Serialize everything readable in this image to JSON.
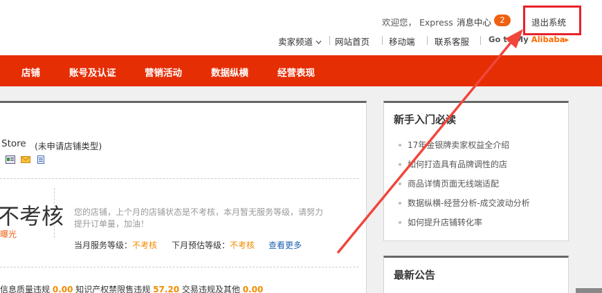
{
  "header": {
    "welcome": "欢迎您， Express",
    "message_center": "消息中心",
    "message_count": "2",
    "logout": "退出系统",
    "subnav": [
      "卖家频道",
      "网站首页",
      "移动端",
      "联系客服"
    ],
    "goto_prefix": "Go to My ",
    "goto_brand": "Alibaba",
    "goto_suffix": "▸"
  },
  "mainnav": [
    "店铺",
    "账号及认证",
    "营销活动",
    "数据纵横",
    "经营表现"
  ],
  "store": {
    "name": "Store",
    "type": "(未申请店铺类型)",
    "status_big": "不考核",
    "status_sub": "曝光",
    "description": "您的店铺，上个月的店铺状态是不考核，本月暂无服务等级，请努力提升订单量，加油！",
    "current_label": "当月服务等级：",
    "current_value": "不考核",
    "next_label": "下月预估等级：",
    "next_value": "不考核",
    "more": "查看更多"
  },
  "violations": {
    "label1": "信息质量违规",
    "value1": "0.00",
    "label2": "知识产权禁限售违规",
    "value2": "57.20",
    "label3": "交易违规及其他",
    "value3": "0.00"
  },
  "guide": {
    "title": "新手入门必读",
    "items": [
      "17年金银牌卖家权益全介绍",
      "如何打造具有品牌调性的店",
      "商品详情页面无线端适配",
      "数据纵横-经营分析-成交波动分析",
      "如何提升店铺转化率"
    ]
  },
  "notice": {
    "title": "最新公告"
  },
  "colors": {
    "nav": "#e62e05",
    "highlight": "#e8202a",
    "accent": "#f08c00",
    "link": "#2062b0"
  }
}
